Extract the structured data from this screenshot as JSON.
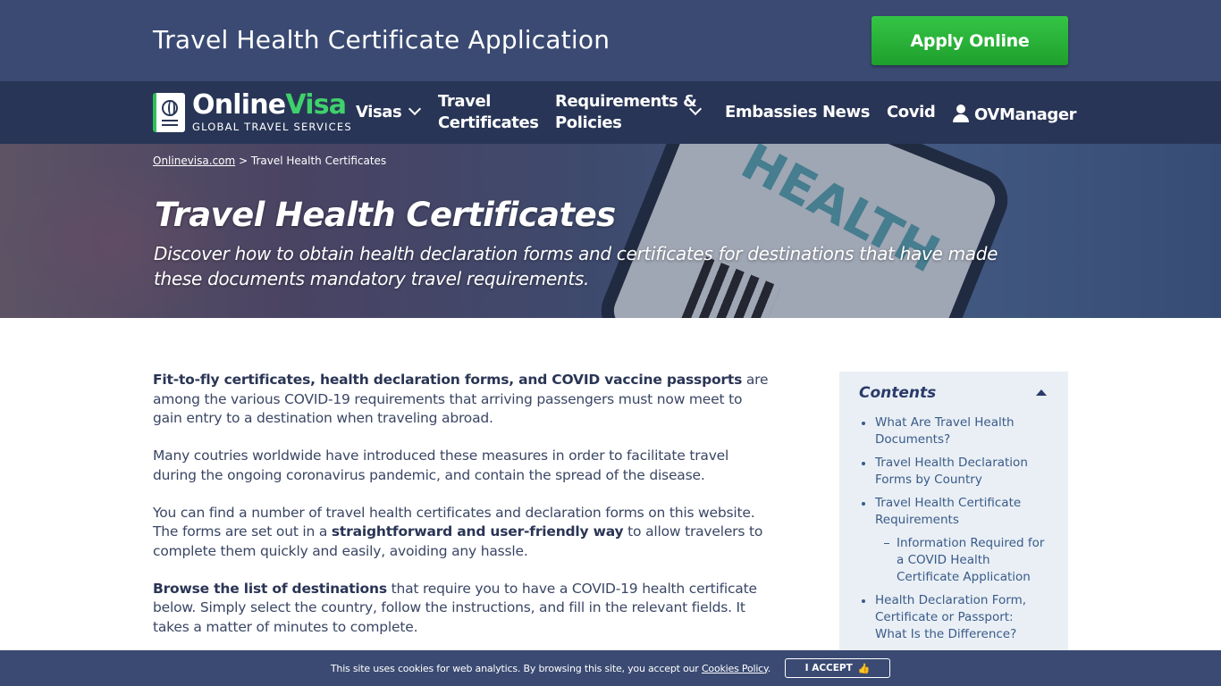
{
  "header": {
    "title": "Travel Health Certificate Application",
    "apply_label": "Apply Online"
  },
  "logo": {
    "name_part1": "Online",
    "name_part2": "Visa",
    "tagline": "GLOBAL TRAVEL SERVICES"
  },
  "nav": {
    "visas": "Visas",
    "travel_certificates_line1": "Travel",
    "travel_certificates_line2": "Certificates",
    "requirements_line1": "Requirements &",
    "requirements_line2": "Policies",
    "embassies": "Embassies",
    "news": "News",
    "covid": "Covid",
    "account": "OVManager"
  },
  "hero": {
    "breadcrumb_home": "Onlinevisa.com",
    "breadcrumb_sep": " > ",
    "breadcrumb_current": "Travel Health Certificates",
    "title": "Travel Health Certificates",
    "subtitle": "Discover how to obtain health declaration forms and certificates for destinations that have made these documents mandatory travel requirements.",
    "phone_text": "HEALTH"
  },
  "content": {
    "p1_bold": "Fit-to-fly certificates, health declaration forms, and COVID vaccine passports",
    "p1_rest": " are among the various COVID-19 requirements that arriving passengers must now meet to gain entry to a destination when traveling abroad.",
    "p2": "Many coutries worldwide have introduced these measures in order to facilitate travel during the ongoing coronavirus pandemic, and contain the spread of the disease.",
    "p3_start": "You can find a number of travel health certificates and declaration forms on this website. The forms are set out in a ",
    "p3_bold": "straightforward and user-friendly way",
    "p3_end": " to allow travelers to complete them quickly and easily, avoiding any hassle.",
    "p4_bold": "Browse the list of destinations",
    "p4_rest": " that require you to have a COVID-19 health certificate below. Simply select the country, follow the instructions, and fill in the relevant fields. It takes a matter of minutes to complete."
  },
  "toc": {
    "title": "Contents",
    "items": [
      "What Are Travel Health Documents?",
      "Travel Health Declaration Forms by Country",
      "Travel Health Certificate Requirements",
      "Information Required for a COVID Health Certificate Application",
      "Health Declaration Form, Certificate or Passport: What Is the Difference?"
    ]
  },
  "cookie": {
    "text": "This site uses cookies for web analytics. By browsing this site, you accept our ",
    "link": "Cookies Policy",
    "end": ".",
    "accept": "I ACCEPT"
  }
}
